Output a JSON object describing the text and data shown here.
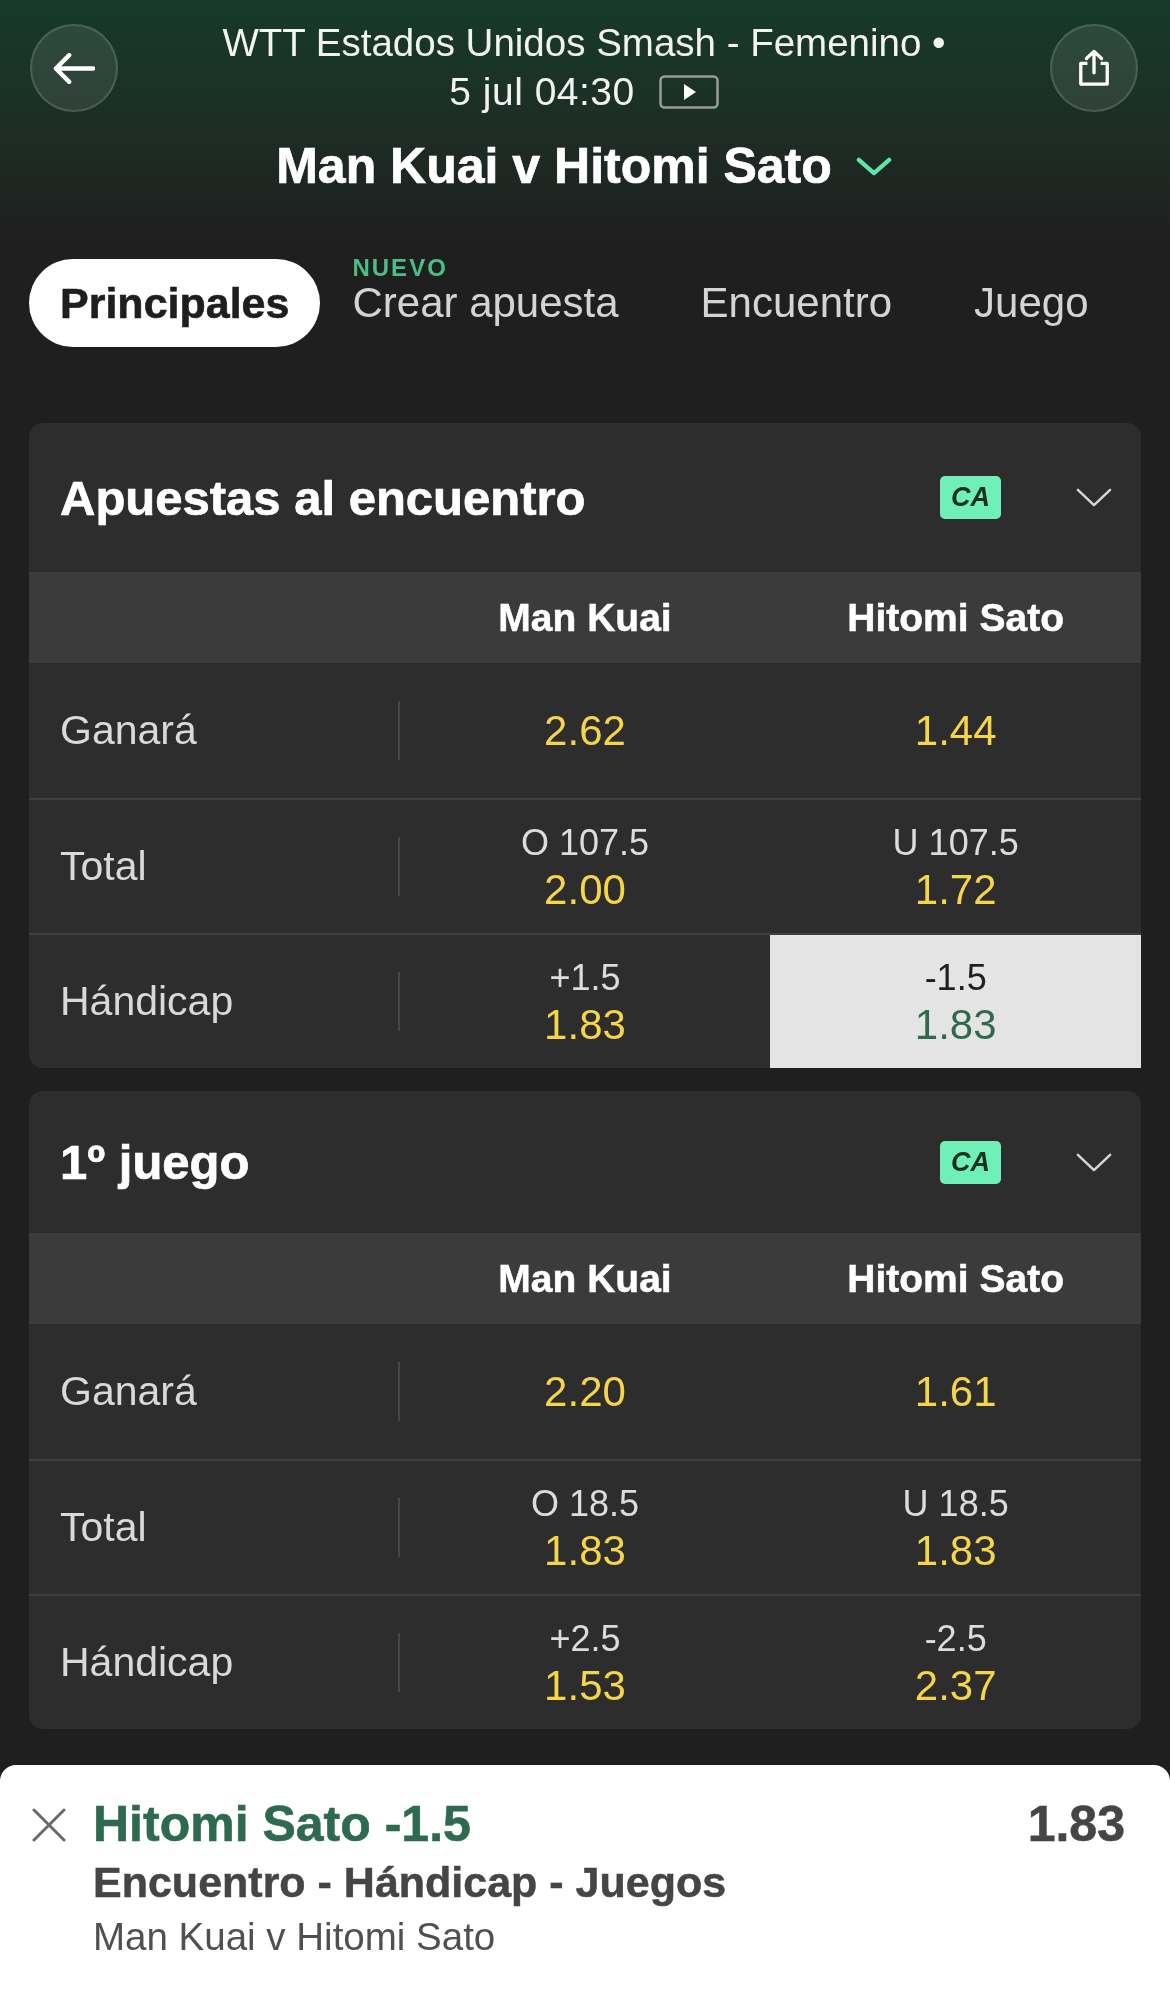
{
  "header": {
    "competition": "WTT Estados Unidos Smash - Femenino •",
    "datetime": "5 jul 04:30",
    "match_title": "Man Kuai v Hitomi Sato"
  },
  "tabs": [
    {
      "label": "Principales",
      "selected": true
    },
    {
      "label": "Crear apuesta",
      "badge": "NUEVO",
      "selected": false
    },
    {
      "label": "Encuentro",
      "selected": false
    },
    {
      "label": "Juego",
      "selected": false
    }
  ],
  "markets": [
    {
      "title": "Apuestas al encuentro",
      "badge": "CA",
      "columns": [
        "Man Kuai",
        "Hitomi Sato"
      ],
      "rows": [
        {
          "label": "Ganará",
          "selections": [
            {
              "odds": "2.62",
              "selected": false
            },
            {
              "odds": "1.44",
              "selected": false
            }
          ]
        },
        {
          "label": "Total",
          "selections": [
            {
              "line": "O 107.5",
              "odds": "2.00",
              "selected": false
            },
            {
              "line": "U 107.5",
              "odds": "1.72",
              "selected": false
            }
          ]
        },
        {
          "label": "Hándicap",
          "selections": [
            {
              "line": "+1.5",
              "odds": "1.83",
              "selected": false
            },
            {
              "line": "-1.5",
              "odds": "1.83",
              "selected": true
            }
          ]
        }
      ]
    },
    {
      "title": "1º juego",
      "badge": "CA",
      "columns": [
        "Man Kuai",
        "Hitomi Sato"
      ],
      "rows": [
        {
          "label": "Ganará",
          "selections": [
            {
              "odds": "2.20",
              "selected": false
            },
            {
              "odds": "1.61",
              "selected": false
            }
          ]
        },
        {
          "label": "Total",
          "selections": [
            {
              "line": "O 18.5",
              "odds": "1.83",
              "selected": false
            },
            {
              "line": "U 18.5",
              "odds": "1.83",
              "selected": false
            }
          ]
        },
        {
          "label": "Hándicap",
          "selections": [
            {
              "line": "+2.5",
              "odds": "1.53",
              "selected": false
            },
            {
              "line": "-2.5",
              "odds": "2.37",
              "selected": false
            }
          ]
        }
      ]
    }
  ],
  "bet_slip": {
    "selection": "Hitomi Sato -1.5",
    "market": "Encuentro - Hándicap - Juegos",
    "event": "Man Kuai v Hitomi Sato",
    "odds": "1.83"
  }
}
